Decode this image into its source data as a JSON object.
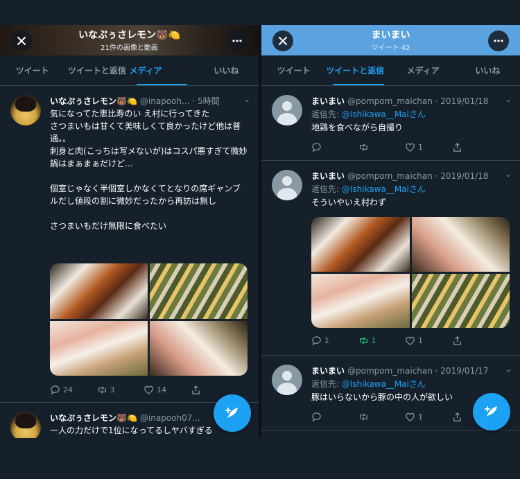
{
  "left": {
    "header": {
      "name": "いなぷぅさレモン🐻🍋",
      "subtitle": "21件の画像と動画"
    },
    "tabs": [
      "ツイート",
      "ツイートと返信",
      "メディア",
      "いいね"
    ],
    "active_tab": 2,
    "tweets": [
      {
        "name": "いなぷぅさレモン🐻🍋",
        "handle_time": "@inapooh... · 5時間",
        "text": "気になってた恵比寿のい え村に行ってきた\nさつまいもは甘くて美味しくて良かったけど他は普通。。\n刺身と肉(こっちは写メないが)はコスパ悪すぎて微妙\n鍋はまぁまぁだけど…\n\n個室じゃなく半個室しかなくてとなりの席ギャンブルだし値段の割に微妙だったから再訪は無し\n\nさつまいもだけ無限に食べたい",
        "replies": "24",
        "retweets": "3",
        "likes": "14"
      },
      {
        "name": "いなぷぅさレモン🐻🍋",
        "handle_time": "@inapooh07...",
        "text": "一人の力だけで1位になってるしヤバすぎる"
      }
    ]
  },
  "right": {
    "header": {
      "name": "まいまい",
      "subtitle": "ツイート 42"
    },
    "tabs": [
      "ツイート",
      "ツイートと返信",
      "メディア",
      "いいね"
    ],
    "active_tab": 1,
    "tweets": [
      {
        "name": "まいまい",
        "handle_time": "@pompom_maichan · 2019/01/18",
        "reply_prefix": "返信先: ",
        "reply_to": "@Ishikawa__Maiさん",
        "text": "地鶏を食べながら自撮り",
        "replies": "",
        "retweets": "",
        "likes": "1"
      },
      {
        "name": "まいまい",
        "handle_time": "@pompom_maichan · 2019/01/18",
        "reply_prefix": "返信先: ",
        "reply_to": "@Ishikawa__Maiさん",
        "text": "そういやいえ村わず",
        "replies": "1",
        "retweets": "1",
        "likes": "1"
      },
      {
        "name": "まいまい",
        "handle_time": "@pompom_maichan · 2019/01/17",
        "reply_prefix": "返信先: ",
        "reply_to": "@Ishikawa__Maiさん",
        "text": "豚はいらないから豚の中の人が欲しい",
        "replies": "",
        "retweets": "",
        "likes": "1"
      }
    ]
  },
  "colors": {
    "accent": "#1da1f2",
    "retweet_active": "#17bf63",
    "background": "#15202b"
  }
}
